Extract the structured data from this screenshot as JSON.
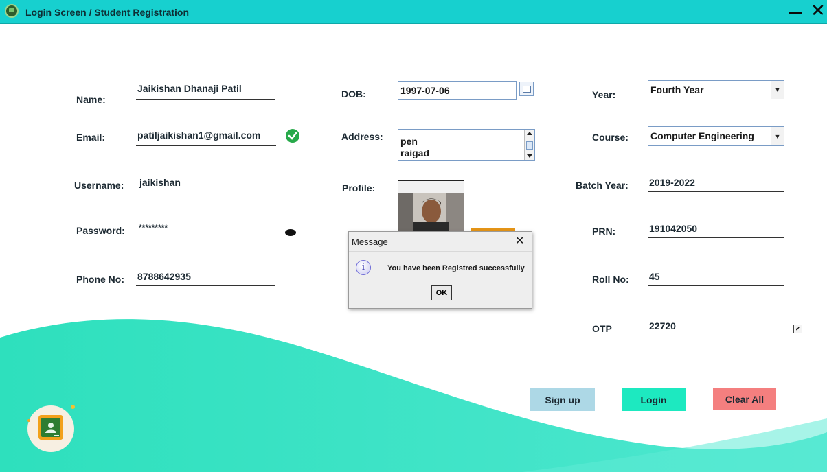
{
  "window": {
    "title": "Login Screen / Student Registration",
    "minimize_glyph": "—",
    "close_glyph": "✕"
  },
  "form": {
    "name": {
      "label": "Name:",
      "value": "Jaikishan Dhanaji Patil"
    },
    "email": {
      "label": "Email:",
      "value": "patiljaikishan1@gmail.com"
    },
    "username": {
      "label": "Username:",
      "value": "jaikishan"
    },
    "password": {
      "label": "Password:",
      "value": "*********"
    },
    "phone": {
      "label": "Phone No:",
      "value": "8788642935"
    },
    "dob": {
      "label": "DOB:",
      "value": "1997-07-06"
    },
    "address": {
      "label": "Address:",
      "lines": [
        "pen",
        "raigad"
      ]
    },
    "profile": {
      "label": "Profile:"
    },
    "year": {
      "label": "Year:",
      "value": "Fourth Year"
    },
    "course": {
      "label": "Course:",
      "value": "Computer Engineering"
    },
    "batch_year": {
      "label": "Batch Year:",
      "value": "2019-2022"
    },
    "prn": {
      "label": "PRN:",
      "value": "191042050"
    },
    "roll_no": {
      "label": "Roll No:",
      "value": "45"
    },
    "otp": {
      "label": "OTP",
      "value": "22720"
    }
  },
  "buttons": {
    "signup": "Sign up",
    "login": "Login",
    "clear_all": "Clear All"
  },
  "dialog": {
    "title": "Message",
    "message": "You have been Registred successfully",
    "ok": "OK",
    "icon": "info-icon"
  },
  "colors": {
    "titlebar": "#17d0cf",
    "wave": "#3fe4c6",
    "signup": "#add8e6",
    "login": "#1de9c0",
    "clear_all": "#f47f7f"
  }
}
